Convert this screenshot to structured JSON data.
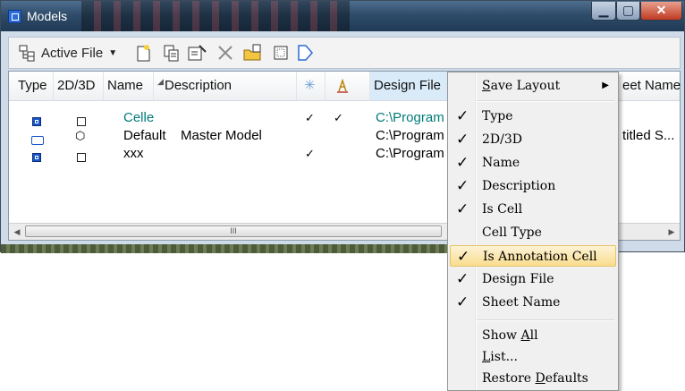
{
  "window": {
    "title": "Models"
  },
  "toolbar": {
    "active_file_label": "Active File"
  },
  "columns": [
    {
      "label": "Type"
    },
    {
      "label": "2D/3D"
    },
    {
      "label": "Name"
    },
    {
      "label": "Description"
    },
    {
      "label": "Design File"
    },
    {
      "label": "eet Name"
    }
  ],
  "rows": [
    {
      "name": "Celle",
      "description": "",
      "is_cell": "✓",
      "is_annotation": "✓",
      "design_file": "C:\\Program",
      "sheet_name": ""
    },
    {
      "name": "Default",
      "description": "Master Model",
      "is_cell": "",
      "is_annotation": "",
      "design_file": "C:\\Program",
      "sheet_name": "titled S..."
    },
    {
      "name": "xxx",
      "description": "",
      "is_cell": "✓",
      "is_annotation": "",
      "design_file": "C:\\Program",
      "sheet_name": ""
    }
  ],
  "scrollbar": {
    "grip": "III"
  },
  "context_menu": {
    "save_layout": {
      "pre": "",
      "u": "S",
      "post": "ave Layout"
    },
    "items": [
      {
        "label": "Type",
        "checked": "✓"
      },
      {
        "label": "2D/3D",
        "checked": "✓"
      },
      {
        "label": "Name",
        "checked": "✓"
      },
      {
        "label": "Description",
        "checked": "✓"
      },
      {
        "label": "Is Cell",
        "checked": "✓"
      },
      {
        "label": "Cell Type",
        "checked": ""
      },
      {
        "label": "Is Annotation Cell",
        "checked": "✓"
      },
      {
        "label": "Design File",
        "checked": "✓"
      },
      {
        "label": "Sheet Name",
        "checked": "✓"
      }
    ],
    "show_all": {
      "pre": "Show ",
      "u": "A",
      "post": "ll"
    },
    "list": {
      "pre": "",
      "u": "L",
      "post": "ist..."
    },
    "restore": {
      "pre": "Restore ",
      "u": "D",
      "post": "efaults"
    }
  }
}
